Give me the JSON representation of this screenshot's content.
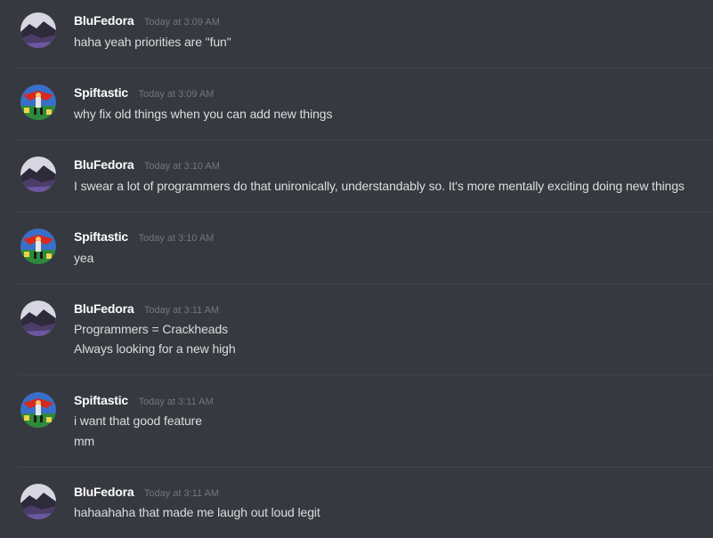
{
  "users": {
    "blu": "BluFedora",
    "spif": "Spiftastic"
  },
  "avatars": {
    "blu": "dark-mountain-avatar",
    "spif": "caped-hero-avatar"
  },
  "messages": [
    {
      "author": "BluFedora",
      "timestamp": "Today at 3:09 AM",
      "lines": [
        "haha yeah priorities are \"fun\""
      ]
    },
    {
      "author": "Spiftastic",
      "timestamp": "Today at 3:09 AM",
      "lines": [
        "why fix old things when you can add new things"
      ]
    },
    {
      "author": "BluFedora",
      "timestamp": "Today at 3:10 AM",
      "lines": [
        "I swear a lot of programmers do that unironically, understandably so. It's more mentally exciting doing new things"
      ]
    },
    {
      "author": "Spiftastic",
      "timestamp": "Today at 3:10 AM",
      "lines": [
        "yea"
      ]
    },
    {
      "author": "BluFedora",
      "timestamp": "Today at 3:11 AM",
      "lines": [
        "Programmers = Crackheads",
        "Always looking for a new high"
      ]
    },
    {
      "author": "Spiftastic",
      "timestamp": "Today at 3:11 AM",
      "lines": [
        "i want that good feature",
        "mm"
      ]
    },
    {
      "author": "BluFedora",
      "timestamp": "Today at 3:11 AM",
      "lines": [
        "hahaahaha that made me laugh out loud legit"
      ]
    }
  ],
  "colors": {
    "background": "#36393f",
    "divider": "#40444b",
    "username": "#ffffff",
    "timestamp": "#72767d",
    "text": "#dcddde"
  }
}
